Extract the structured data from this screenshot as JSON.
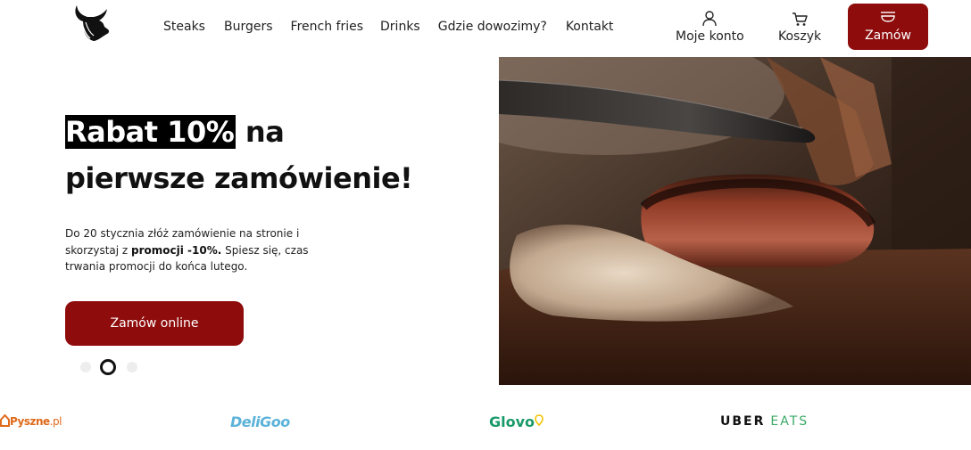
{
  "header": {
    "logo_icon": "bull-head-icon",
    "nav": [
      "Steaks",
      "Burgers",
      "French fries",
      "Drinks",
      "Gdzie dowozimy?",
      "Kontakt"
    ],
    "account_label": "Moje konto",
    "account_icon": "user-icon",
    "cart_label": "Koszyk",
    "cart_icon": "cart-icon",
    "order_label": "Zamów",
    "order_icon": "food-bowl-icon",
    "accent_color": "#8e0c0c"
  },
  "hero": {
    "title_highlight": "Rabat 10%",
    "title_rest_line1": " na",
    "title_line2": "pierwsze zamówienie!",
    "text_before": "Do 20 stycznia złóż zamówienie na stronie i skorzystaj z ",
    "text_bold": "promocji -10%.",
    "text_after": " Spiesz się, czas trwania promocji do końca lutego.",
    "cta_label": "Zamów online",
    "slides_count": 3,
    "active_slide": 2
  },
  "partners": {
    "pyszne_main": "Pyszne",
    "pyszne_suffix": ".pl",
    "deligoo": "DeliGoo",
    "glovo": "Glovo",
    "uber_main": "UBER",
    "uber_suffix": "EATS"
  }
}
